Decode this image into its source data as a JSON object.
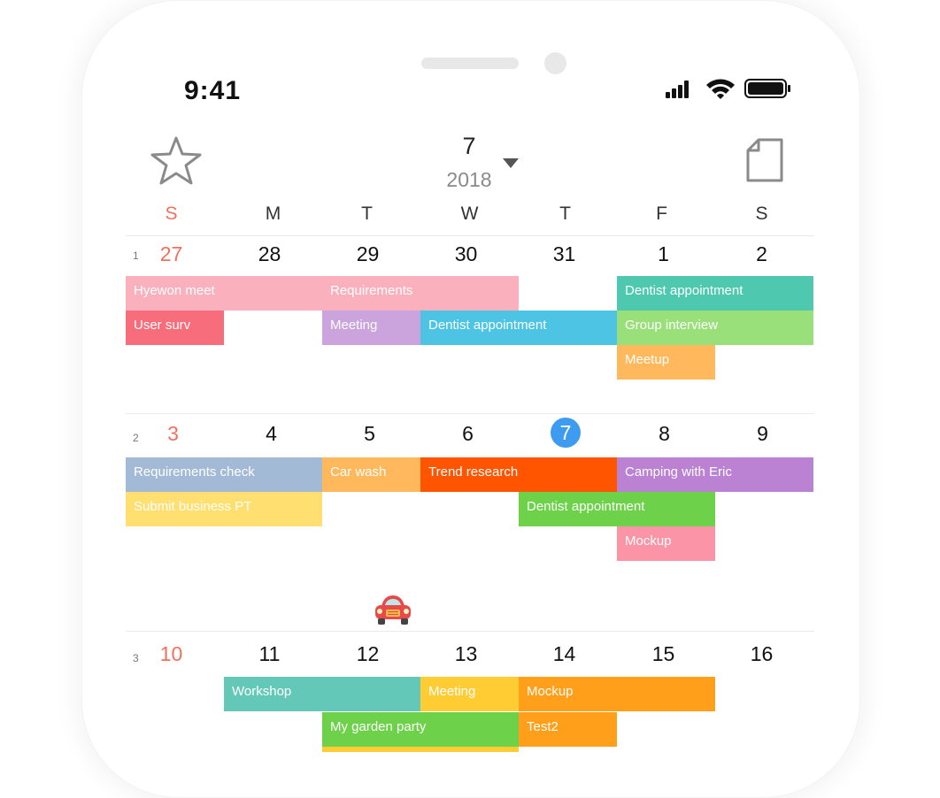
{
  "status_bar": {
    "time": "9:41"
  },
  "header": {
    "month": "7",
    "year": "2018"
  },
  "weekdays": [
    "S",
    "M",
    "T",
    "W",
    "T",
    "F",
    "S"
  ],
  "weeks": [
    {
      "number": "1",
      "dates": [
        "27",
        "28",
        "29",
        "30",
        "31",
        "1",
        "2"
      ],
      "events": [
        {
          "label": "Hyewon meet",
          "color": "#fbb1bd"
        },
        {
          "label": "Requirements",
          "color": "#fbb1bd"
        },
        {
          "label": "Dentist appointment",
          "color": "#4ec9b0"
        },
        {
          "label": "User surv",
          "color": "#f76d7b"
        },
        {
          "label": "Meeting",
          "color": "#cba4dd"
        },
        {
          "label": "Dentist appointment",
          "color": "#4dc4e4"
        },
        {
          "label": "Group interview",
          "color": "#9ae07a"
        },
        {
          "label": "Meetup",
          "color": "#ffb85c"
        }
      ]
    },
    {
      "number": "2",
      "dates": [
        "3",
        "4",
        "5",
        "6",
        "7",
        "8",
        "9"
      ],
      "today": "7",
      "events": [
        {
          "label": "Requirements check",
          "color": "#a3bad6"
        },
        {
          "label": "Car wash",
          "color": "#ffb85c"
        },
        {
          "label": "Trend research",
          "color": "#ff5500"
        },
        {
          "label": "Camping with Eric",
          "color": "#bb82d4"
        },
        {
          "label": "Submit business PT",
          "color": "#ffdf70"
        },
        {
          "label": "Dentist appointment",
          "color": "#6dd24a"
        },
        {
          "label": "Mockup",
          "color": "#fb94a6"
        }
      ]
    },
    {
      "number": "3",
      "dates": [
        "10",
        "11",
        "12",
        "13",
        "14",
        "15",
        "16"
      ],
      "events": [
        {
          "label": "Workshop",
          "color": "#64c8b8"
        },
        {
          "label": "Meeting",
          "color": "#ffcc33"
        },
        {
          "label": "Mockup",
          "color": "#ff9f1a"
        },
        {
          "label": "My garden party",
          "color": "#6dd24a"
        },
        {
          "label": "Test2",
          "color": "#ff9f1a"
        }
      ]
    }
  ],
  "icons": {
    "favorite": "star-icon",
    "notes": "document-icon",
    "dropdown": "caret-down-icon",
    "sticker": "car-icon"
  },
  "colors": {
    "sunday": "#f2705e",
    "today": "#3d9cf0"
  }
}
